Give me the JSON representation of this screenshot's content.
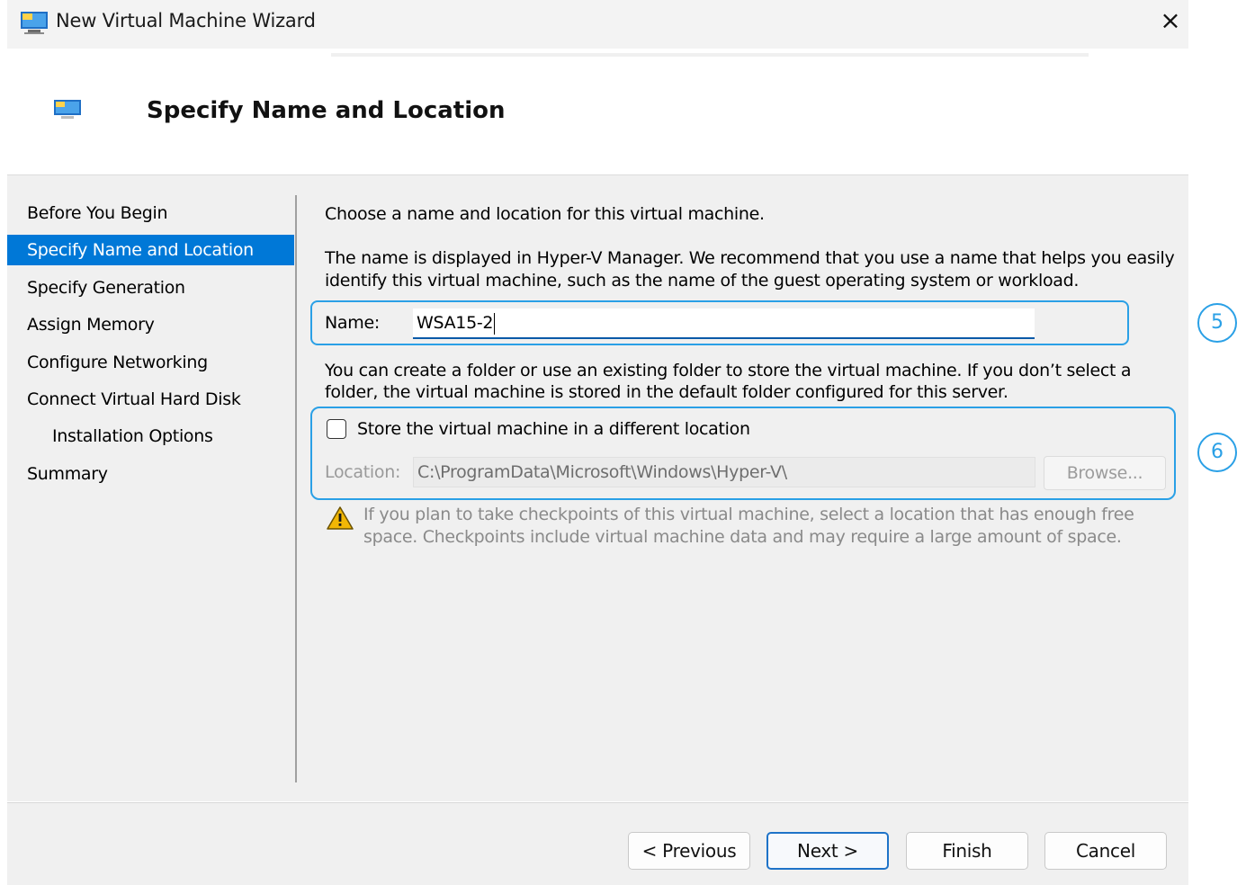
{
  "window": {
    "title": "New Virtual Machine Wizard",
    "close_glyph": "×"
  },
  "header": {
    "title": "Specify Name and Location"
  },
  "nav": {
    "items": [
      {
        "label": "Before You Begin",
        "selected": false,
        "indent": false
      },
      {
        "label": "Specify Name and Location",
        "selected": true,
        "indent": false
      },
      {
        "label": "Specify Generation",
        "selected": false,
        "indent": false
      },
      {
        "label": "Assign Memory",
        "selected": false,
        "indent": false
      },
      {
        "label": "Configure Networking",
        "selected": false,
        "indent": false
      },
      {
        "label": "Connect Virtual Hard Disk",
        "selected": false,
        "indent": false
      },
      {
        "label": "Installation Options",
        "selected": false,
        "indent": true
      },
      {
        "label": "Summary",
        "selected": false,
        "indent": false
      }
    ]
  },
  "content": {
    "intro": "Choose a name and location for this virtual machine.",
    "name_help_1": "The name is displayed in Hyper-V Manager. We recommend that you use a name that helps you easily",
    "name_help_2": "identify this virtual machine, such as the name of the guest operating system or workload.",
    "name_label": "Name:",
    "name_value": "WSA15-2",
    "folder_help_1": "You can create a folder or use an existing folder to store the virtual machine. If you don’t select a",
    "folder_help_2": "folder, the virtual machine is stored in the default folder configured for this server.",
    "store_label": "Store the virtual machine in a different location",
    "store_checked": false,
    "location_label": "Location:",
    "location_value": "C:\\ProgramData\\Microsoft\\Windows\\Hyper-V\\",
    "browse_label": "Browse...",
    "warning_1": "If you plan to take checkpoints of this virtual machine, select a location that has enough free",
    "warning_2": "space. Checkpoints include virtual machine data and may require a large amount of space."
  },
  "callouts": {
    "first": "5",
    "second": "6"
  },
  "buttons": {
    "previous": "< Previous",
    "next": "Next >",
    "finish": "Finish",
    "cancel": "Cancel"
  },
  "colors": {
    "accent": "#0078d7",
    "callout": "#2aa0e6",
    "warning": "#f2b705"
  },
  "icons": {
    "title": "hyper-v-monitor-icon",
    "header": "hyper-v-monitor-icon",
    "warning": "warning-triangle-icon",
    "close": "close-icon"
  }
}
